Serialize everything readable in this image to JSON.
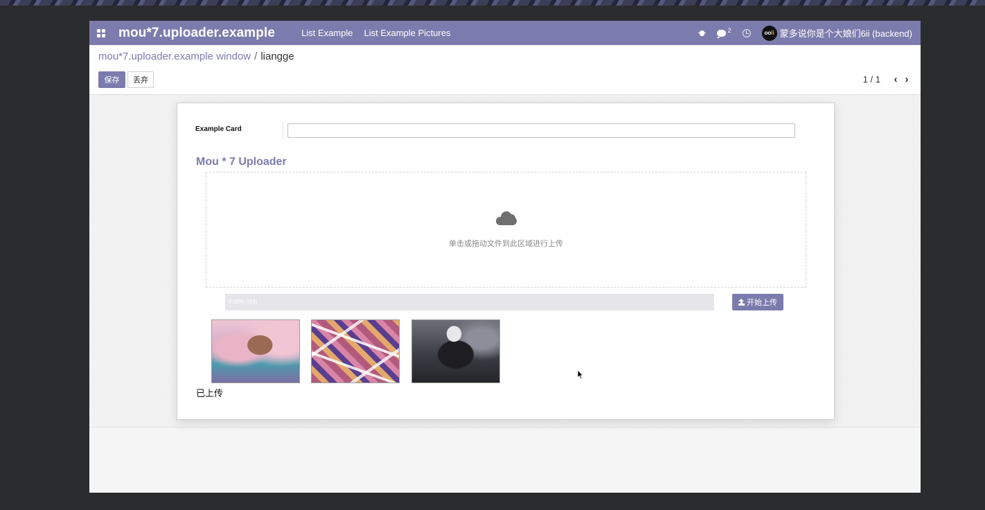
{
  "navbar": {
    "brand": "mou*7.uploader.example",
    "menus": [
      "List Example",
      "List Example Pictures"
    ],
    "message_count": "2",
    "user": {
      "avatar_text_left": "oo",
      "avatar_text_right": "li",
      "name": "蒙多说你是个大娘们6ii (backend)"
    }
  },
  "control_panel": {
    "breadcrumb_parent": "mou*7.uploader.example window",
    "breadcrumb_separator": "/",
    "breadcrumb_current": "liangge",
    "save_label": "保存",
    "discard_label": "丢弃",
    "pager_value": "1 / 1",
    "pager_prev": "‹",
    "pager_next": "›"
  },
  "form": {
    "example_card_label": "Example Card",
    "example_card_value": "",
    "uploader_title": "Mou * 7 Uploader",
    "dropzone_text": "单击或拖动文件到此区域进行上传",
    "progress_text": "0.00% (0/3)",
    "progress_fraction": 0.0,
    "upload_button_label": "开始上传",
    "uploaded_label": "已上传"
  },
  "thumbnails": [
    {
      "name": "uploaded-image-1"
    },
    {
      "name": "uploaded-image-2"
    },
    {
      "name": "uploaded-image-3"
    }
  ],
  "colors": {
    "brand": "#7c7bad",
    "backdrop": "#2b2c2d"
  }
}
